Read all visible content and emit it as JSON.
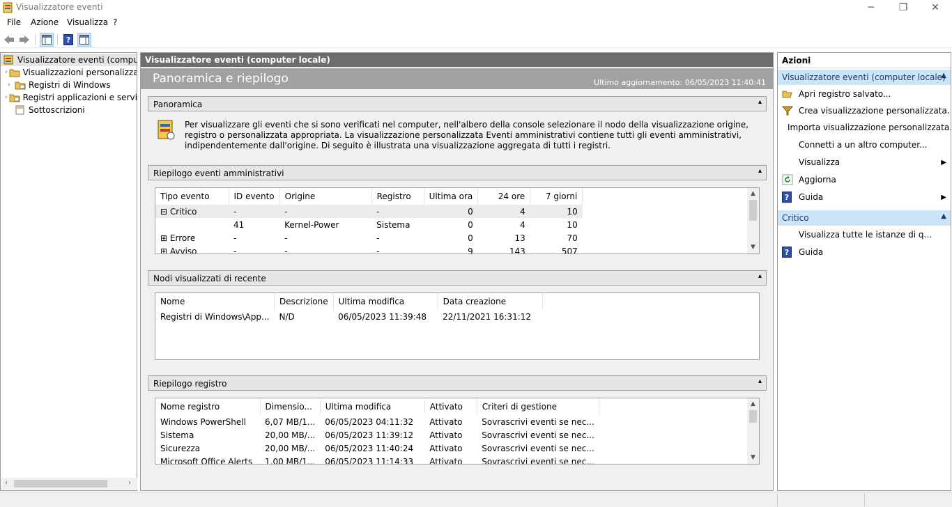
{
  "window": {
    "title": "Visualizzatore eventi"
  },
  "menu": [
    "File",
    "Azione",
    "Visualizza",
    "?"
  ],
  "tree": {
    "items": [
      {
        "label": "Visualizzatore eventi (computer locale)",
        "selected": true,
        "expander": ""
      },
      {
        "label": "Visualizzazioni personalizzate",
        "expander": "›"
      },
      {
        "label": "Registri di Windows",
        "expander": "›"
      },
      {
        "label": "Registri applicazioni e servizi",
        "expander": "›"
      },
      {
        "label": "Sottoscrizioni",
        "expander": ""
      }
    ]
  },
  "center": {
    "header": "Visualizzatore eventi (computer locale)",
    "banner_title": "Panoramica e riepilogo",
    "last_update": "Ultimo aggiornamento: 06/05/2023 11:40:41",
    "overview": {
      "title": "Panoramica",
      "text": "Per visualizzare gli eventi che si sono verificati nel computer, nell'albero della console selezionare il nodo della visualizzazione origine, registro o personalizzata appropriata. La visualizzazione personalizzata Eventi amministrativi contiene tutti gli eventi amministrativi, indipendentemente dall'origine. Di seguito è illustrata una visualizzazione aggregata di tutti i registri."
    },
    "admin_summary": {
      "title": "Riepilogo eventi amministrativi",
      "columns": [
        "Tipo evento",
        "ID evento",
        "Origine",
        "Registro",
        "Ultima ora",
        "24 ore",
        "7 giorni"
      ],
      "rows": [
        {
          "expander": "⊟",
          "type": "Critico",
          "id": "-",
          "source": "-",
          "log": "-",
          "hour": "0",
          "day": "4",
          "week": "10"
        },
        {
          "expander": "",
          "type": "",
          "id": "41",
          "source": "Kernel-Power",
          "log": "Sistema",
          "hour": "0",
          "day": "4",
          "week": "10"
        },
        {
          "expander": "⊞",
          "type": "Errore",
          "id": "-",
          "source": "-",
          "log": "-",
          "hour": "0",
          "day": "13",
          "week": "70"
        },
        {
          "expander": "⊞",
          "type": "Avviso",
          "id": "-",
          "source": "-",
          "log": "-",
          "hour": "9",
          "day": "143",
          "week": "507"
        }
      ]
    },
    "recent_nodes": {
      "title": "Nodi visualizzati di recente",
      "columns": [
        "Nome",
        "Descrizione",
        "Ultima modifica",
        "Data creazione"
      ],
      "rows": [
        {
          "name": "Registri di Windows\\App...",
          "desc": "N/D",
          "modified": "06/05/2023 11:39:48",
          "created": "22/11/2021 16:31:12"
        }
      ]
    },
    "log_summary": {
      "title": "Riepilogo registro",
      "columns": [
        "Nome registro",
        "Dimensio...",
        "Ultima modifica",
        "Attivato",
        "Criteri di gestione"
      ],
      "rows": [
        {
          "name": "Windows PowerShell",
          "size": "6,07 MB/1...",
          "modified": "06/05/2023 04:11:32",
          "enabled": "Attivato",
          "policy": "Sovrascrivi eventi se nec..."
        },
        {
          "name": "Sistema",
          "size": "20,00 MB/...",
          "modified": "06/05/2023 11:39:12",
          "enabled": "Attivato",
          "policy": "Sovrascrivi eventi se nec..."
        },
        {
          "name": "Sicurezza",
          "size": "20,00 MB/...",
          "modified": "06/05/2023 11:40:24",
          "enabled": "Attivato",
          "policy": "Sovrascrivi eventi se nec..."
        },
        {
          "name": "Microsoft Office Alerts",
          "size": "1,00 MB/1...",
          "modified": "06/05/2023 11:14:33",
          "enabled": "Attivato",
          "policy": "Sovrascrivi eventi se nec..."
        }
      ]
    }
  },
  "actions": {
    "title": "Azioni",
    "group1": {
      "title": "Visualizzatore eventi (computer locale)",
      "items": [
        {
          "label": "Apri registro salvato...",
          "icon": "folder-open-icon"
        },
        {
          "label": "Crea visualizzazione personalizzata...",
          "icon": "filter-icon"
        },
        {
          "label": "Importa visualizzazione personalizzata...",
          "icon": ""
        },
        {
          "label": "Connetti a un altro computer...",
          "icon": ""
        },
        {
          "label": "Visualizza",
          "icon": "",
          "submenu": true
        },
        {
          "label": "Aggiorna",
          "icon": "refresh-icon"
        },
        {
          "label": "Guida",
          "icon": "help-icon",
          "submenu": true
        }
      ]
    },
    "group2": {
      "title": "Critico",
      "items": [
        {
          "label": "Visualizza tutte le istanze di questo evento",
          "icon": ""
        },
        {
          "label": "Guida",
          "icon": "help-icon"
        }
      ]
    }
  },
  "colors": {
    "accent_header": "#6d6d6d",
    "banner": "#a2a2a2",
    "actions_group": "#cce4f7"
  }
}
